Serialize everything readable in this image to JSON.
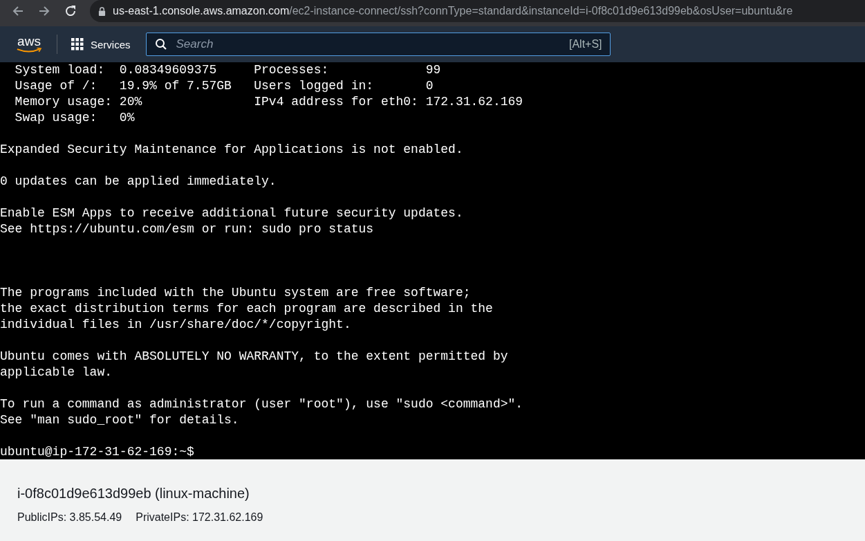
{
  "browser": {
    "url_host": "us-east-1.console.aws.amazon.com",
    "url_path": "/ec2-instance-connect/ssh?connType=standard&instanceId=i-0f8c01d9e613d99eb&osUser=ubuntu&re"
  },
  "console_nav": {
    "logo": "aws",
    "services": "Services",
    "search": {
      "placeholder": "Search",
      "shortcut": "[Alt+S]"
    }
  },
  "terminal": {
    "blocks": [
      {
        "wide_gap": false,
        "lines": [
          "  System load:  0.08349609375     Processes:             99",
          "  Usage of /:   19.9% of 7.57GB   Users logged in:       0",
          "  Memory usage: 20%               IPv4 address for eth0: 172.31.62.169",
          "  Swap usage:   0%"
        ]
      },
      {
        "wide_gap": false,
        "lines": [
          "Expanded Security Maintenance for Applications is not enabled."
        ]
      },
      {
        "wide_gap": false,
        "lines": [
          "0 updates can be applied immediately."
        ]
      },
      {
        "wide_gap": false,
        "lines": [
          "Enable ESM Apps to receive additional future security updates.",
          "See https://ubuntu.com/esm or run: sudo pro status"
        ]
      },
      {
        "wide_gap": true,
        "lines": [
          "The programs included with the Ubuntu system are free software;",
          "the exact distribution terms for each program are described in the",
          "individual files in /usr/share/doc/*/copyright."
        ]
      },
      {
        "wide_gap": false,
        "lines": [
          "Ubuntu comes with ABSOLUTELY NO WARRANTY, to the extent permitted by",
          "applicable law."
        ]
      },
      {
        "wide_gap": false,
        "lines": [
          "To run a command as administrator (user \"root\"), use \"sudo <command>\".",
          "See \"man sudo_root\" for details."
        ]
      },
      {
        "wide_gap": false,
        "lines": [
          "ubuntu@ip-172-31-62-169:~$"
        ]
      }
    ]
  },
  "instance": {
    "title": "i-0f8c01d9e613d99eb (linux-machine)",
    "public_ips": "PublicIPs: 3.85.54.49",
    "private_ips": "PrivateIPs: 172.31.62.169"
  }
}
